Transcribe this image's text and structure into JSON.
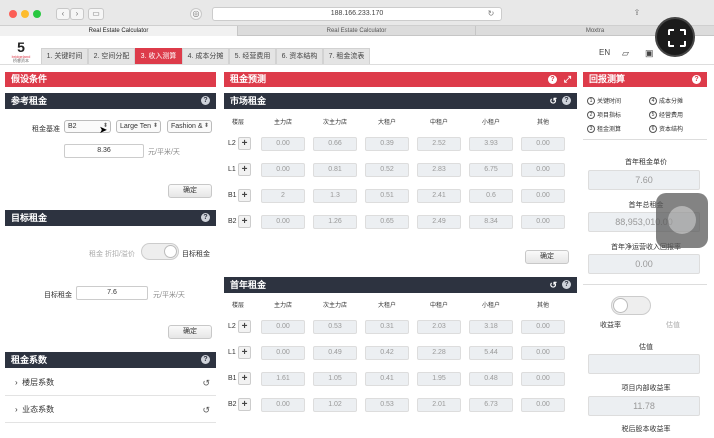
{
  "browser": {
    "url": "188.166.233.170",
    "tabs": [
      "Real Estate Calculator",
      "Real Estate Calculator",
      "Moxtra"
    ]
  },
  "app": {
    "logo_text": "bridgeland",
    "logo_sub": "桥睿资本",
    "tabs": [
      "1. 关键时间",
      "2. 空间分配",
      "3. 收入测算",
      "4. 成本分摊",
      "5. 经营费用",
      "6. 资本结构",
      "7. 租金流表"
    ],
    "active_tab": 2,
    "lang": "EN"
  },
  "left": {
    "title": "假设条件",
    "ref_rent": {
      "title": "参考租金",
      "basis_label": "租金基准",
      "sel1": "B2",
      "sel2": "Large Ten",
      "sel3": "Fashion &",
      "value": "8.36",
      "unit": "元/平米/天",
      "confirm": "确定"
    },
    "target_rent": {
      "title": "目标租金",
      "toggle_off": "租金 折扣/溢价",
      "toggle_on": "目标租金",
      "label": "目标租金",
      "value": "7.6",
      "unit": "元/平米/天",
      "confirm": "确定"
    },
    "coef": {
      "title": "租金系数",
      "items": [
        "楼层系数",
        "业态系数"
      ]
    }
  },
  "mid": {
    "title": "租金预测",
    "market": {
      "title": "市场租金",
      "cols": [
        "楼层",
        "主力店",
        "次主力店",
        "大租户",
        "中租户",
        "小租户",
        "其他"
      ],
      "rows": [
        {
          "floor": "L2",
          "vals": [
            "0.00",
            "0.66",
            "0.39",
            "2.52",
            "3.93",
            "0.00"
          ]
        },
        {
          "floor": "L1",
          "vals": [
            "0.00",
            "0.81",
            "0.52",
            "2.83",
            "6.75",
            "0.00"
          ]
        },
        {
          "floor": "B1",
          "vals": [
            "2",
            "1.3",
            "0.51",
            "2.41",
            "0.6",
            "0.00"
          ]
        },
        {
          "floor": "B2",
          "vals": [
            "0.00",
            "1.26",
            "0.65",
            "2.49",
            "8.34",
            "0.00"
          ]
        }
      ],
      "confirm": "确定"
    },
    "first_year": {
      "title": "首年租金",
      "cols": [
        "楼层",
        "主力店",
        "次主力店",
        "大租户",
        "中租户",
        "小租户",
        "其他"
      ],
      "rows": [
        {
          "floor": "L2",
          "vals": [
            "0.00",
            "0.53",
            "0.31",
            "2.03",
            "3.18",
            "0.00"
          ]
        },
        {
          "floor": "L1",
          "vals": [
            "0.00",
            "0.49",
            "0.42",
            "2.28",
            "5.44",
            "0.00"
          ]
        },
        {
          "floor": "B1",
          "vals": [
            "1.61",
            "1.05",
            "0.41",
            "1.95",
            "0.48",
            "0.00"
          ]
        },
        {
          "floor": "B2",
          "vals": [
            "0.00",
            "1.02",
            "0.53",
            "2.01",
            "6.73",
            "0.00"
          ]
        }
      ]
    }
  },
  "right": {
    "title": "回报测算",
    "legend": [
      {
        "n": "1",
        "label": "关键时间"
      },
      {
        "n": "4",
        "label": "成本分摊"
      },
      {
        "n": "2",
        "label": "项目指标"
      },
      {
        "n": "5",
        "label": "经营费用"
      },
      {
        "n": "3",
        "label": "租金测算"
      },
      {
        "n": "6",
        "label": "资本结构"
      }
    ],
    "first_year_unit_rent": {
      "label": "首年租金单价",
      "value": "7.60"
    },
    "first_year_total_rent": {
      "label": "首年总租金",
      "value": "88,953,010.00"
    },
    "first_year_net_yield": {
      "label": "首年净运营收入回报率",
      "value": "0.00"
    },
    "toggle_left": "收益率",
    "toggle_right": "估值",
    "valuation": {
      "label": "估值",
      "value": ""
    },
    "irr": {
      "label": "项目内部收益率",
      "value": "11.78"
    },
    "after_tax": {
      "label": "税后股本收益率"
    }
  },
  "colors": {
    "accent": "#dd3b4a",
    "dark": "#2d3340"
  }
}
